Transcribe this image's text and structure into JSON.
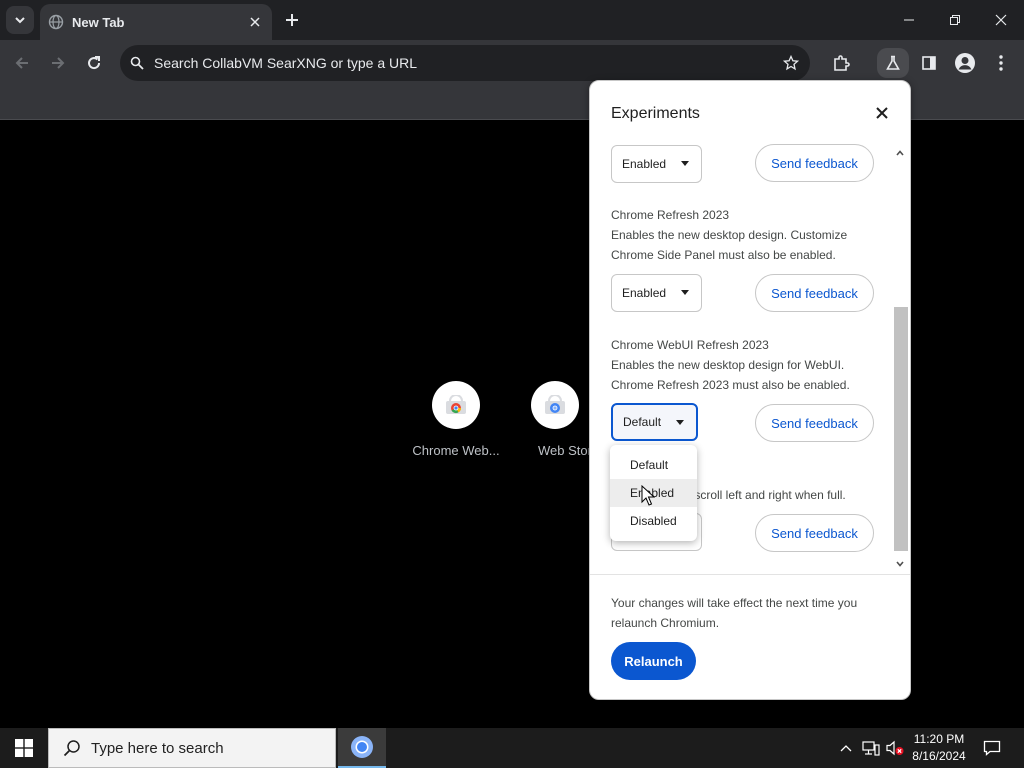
{
  "tab": {
    "title": "New Tab"
  },
  "omnibox": {
    "placeholder": "Search CollabVM SearXNG or type a URL"
  },
  "shortcuts": [
    {
      "label": "Chrome Web..."
    },
    {
      "label": "Web Store"
    }
  ],
  "experiments": {
    "title": "Experiments",
    "flags": [
      {
        "name": "",
        "description": "",
        "value": "Enabled",
        "feedback": "Send feedback"
      },
      {
        "name": "Chrome Refresh 2023",
        "description": "Enables the new desktop design. Customize Chrome Side Panel must also be enabled.",
        "value": "Enabled",
        "feedback": "Send feedback"
      },
      {
        "name": "Chrome WebUI Refresh 2023",
        "description": "Enables the new desktop design for WebUI. Chrome Refresh 2023 must also be enabled.",
        "value": "Default",
        "feedback": "Send feedback"
      },
      {
        "name": "",
        "description": "to scroll left and right when full.",
        "value": "",
        "feedback": "Send feedback"
      }
    ],
    "dropdown_options": [
      "Default",
      "Enabled",
      "Disabled"
    ],
    "footer": "Your changes will take effect the next time you relaunch Chromium.",
    "relaunch_label": "Relaunch"
  },
  "taskbar": {
    "search_placeholder": "Type here to search",
    "time": "11:20 PM",
    "date": "8/16/2024"
  },
  "colors": {
    "accent": "#0b57d0",
    "chrome_dark": "#35363a",
    "tabstrip": "#202124"
  }
}
